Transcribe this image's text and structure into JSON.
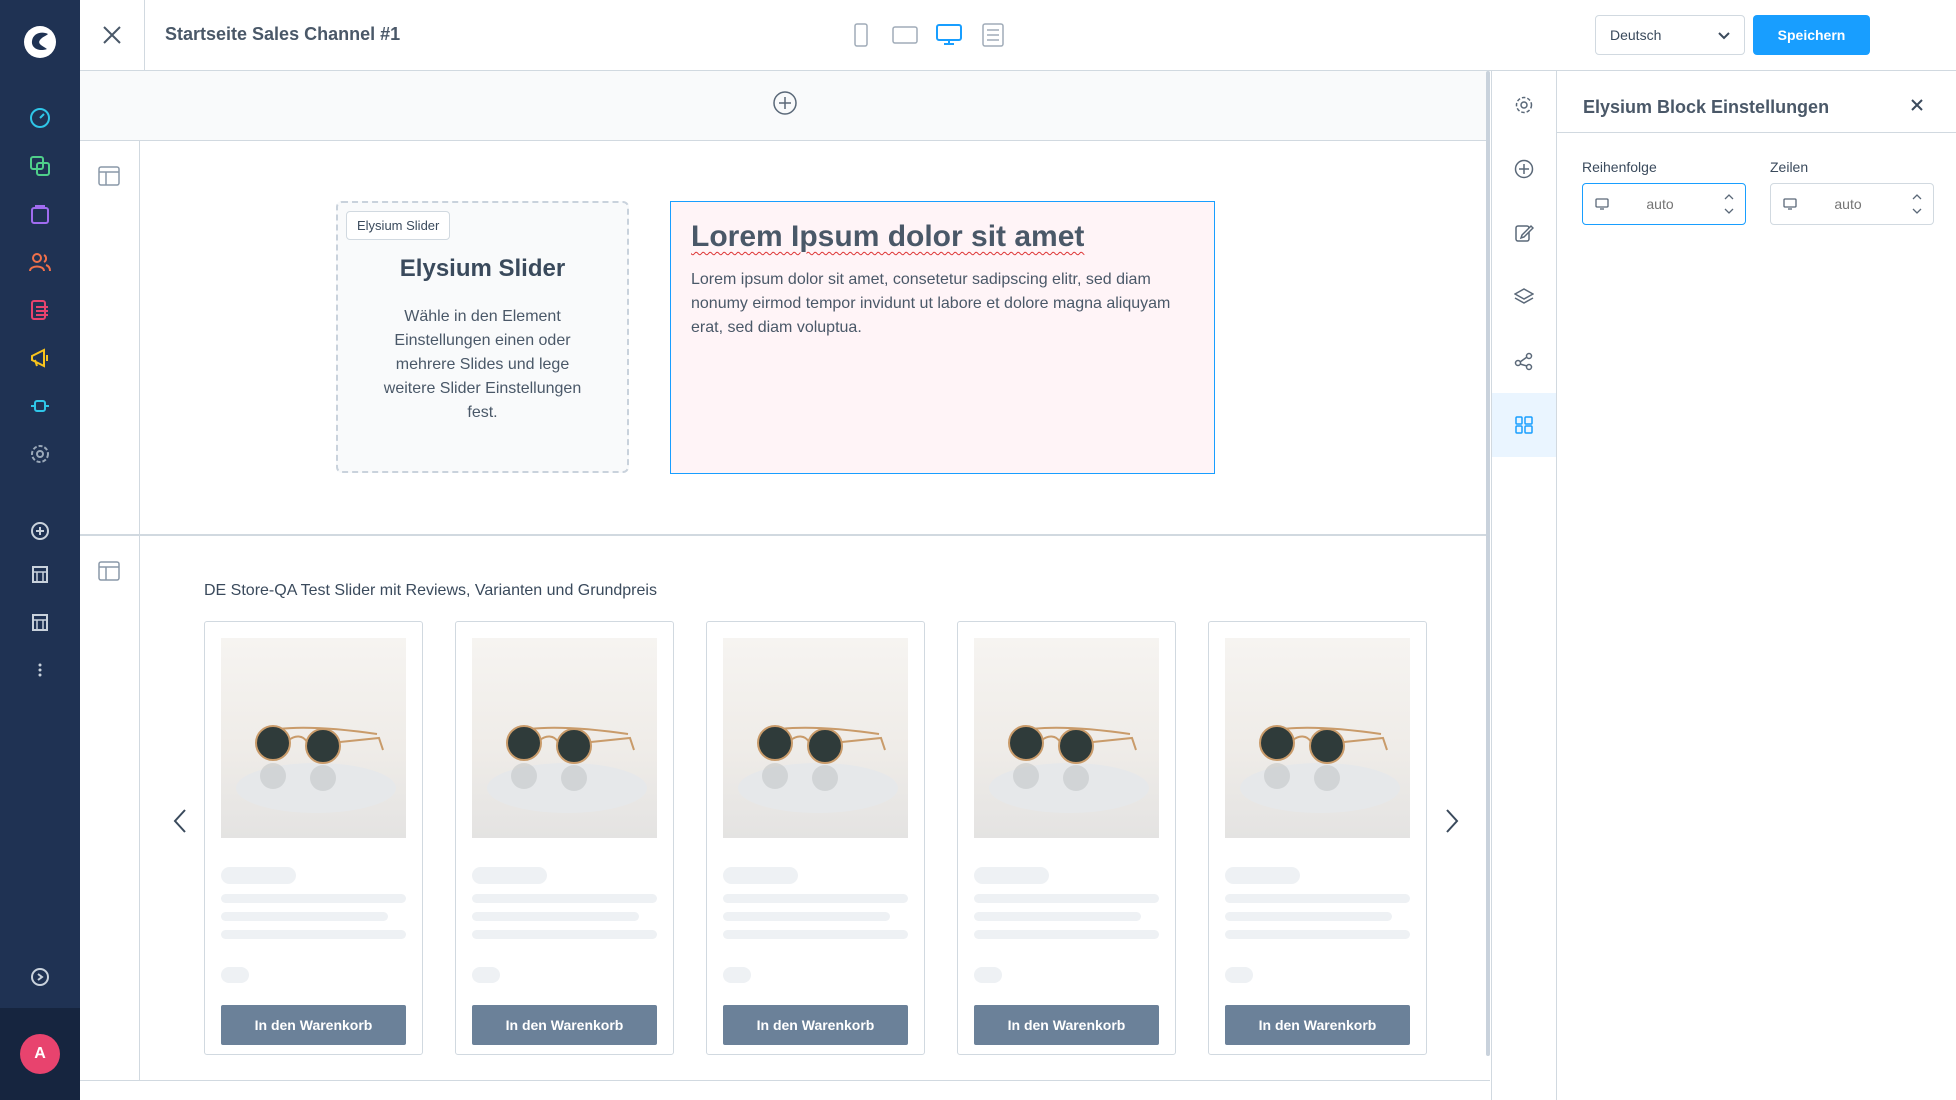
{
  "topbar": {
    "title": "Startseite Sales Channel #1",
    "language": "Deutsch",
    "save_label": "Speichern"
  },
  "sidebar": {
    "avatar_initial": "A",
    "icons": [
      "dashboard-icon",
      "catalogue-icon",
      "orders-icon",
      "customers-icon",
      "content-icon",
      "marketing-icon",
      "extensions-icon",
      "settings-icon",
      "add-sales-channel-icon",
      "storefront-icon",
      "storefront-icon",
      "more-icon",
      "help-icon"
    ]
  },
  "canvas": {
    "slider_badge": "Elysium Slider",
    "slider_title": "Elysium Slider",
    "slider_text": "Wähle in den Element Einstellungen einen oder mehrere Slides und lege weitere Slider Einstellungen fest.",
    "text_block_title": "Lorem Ipsum dolor sit amet",
    "text_block_body": "Lorem ipsum dolor sit amet, consetetur sadipscing elitr, sed diam nonumy eirmod tempor invidunt ut labore et dolore magna aliquyam erat, sed diam voluptua.",
    "product_slider_title": "DE Store-QA Test Slider mit Reviews, Varianten und Grundpreis",
    "cart_button_label": "In den Warenkorb",
    "card_count": 5
  },
  "panel": {
    "title": "Elysium Block Einstellungen",
    "order_label": "Reihenfolge",
    "order_value": "auto",
    "rows_label": "Zeilen",
    "rows_value": "auto"
  },
  "colors": {
    "sidebar": "#1f3253",
    "accent": "#189eff",
    "cart_button": "#6b8199",
    "text_block_bg": "#fff4f7"
  }
}
